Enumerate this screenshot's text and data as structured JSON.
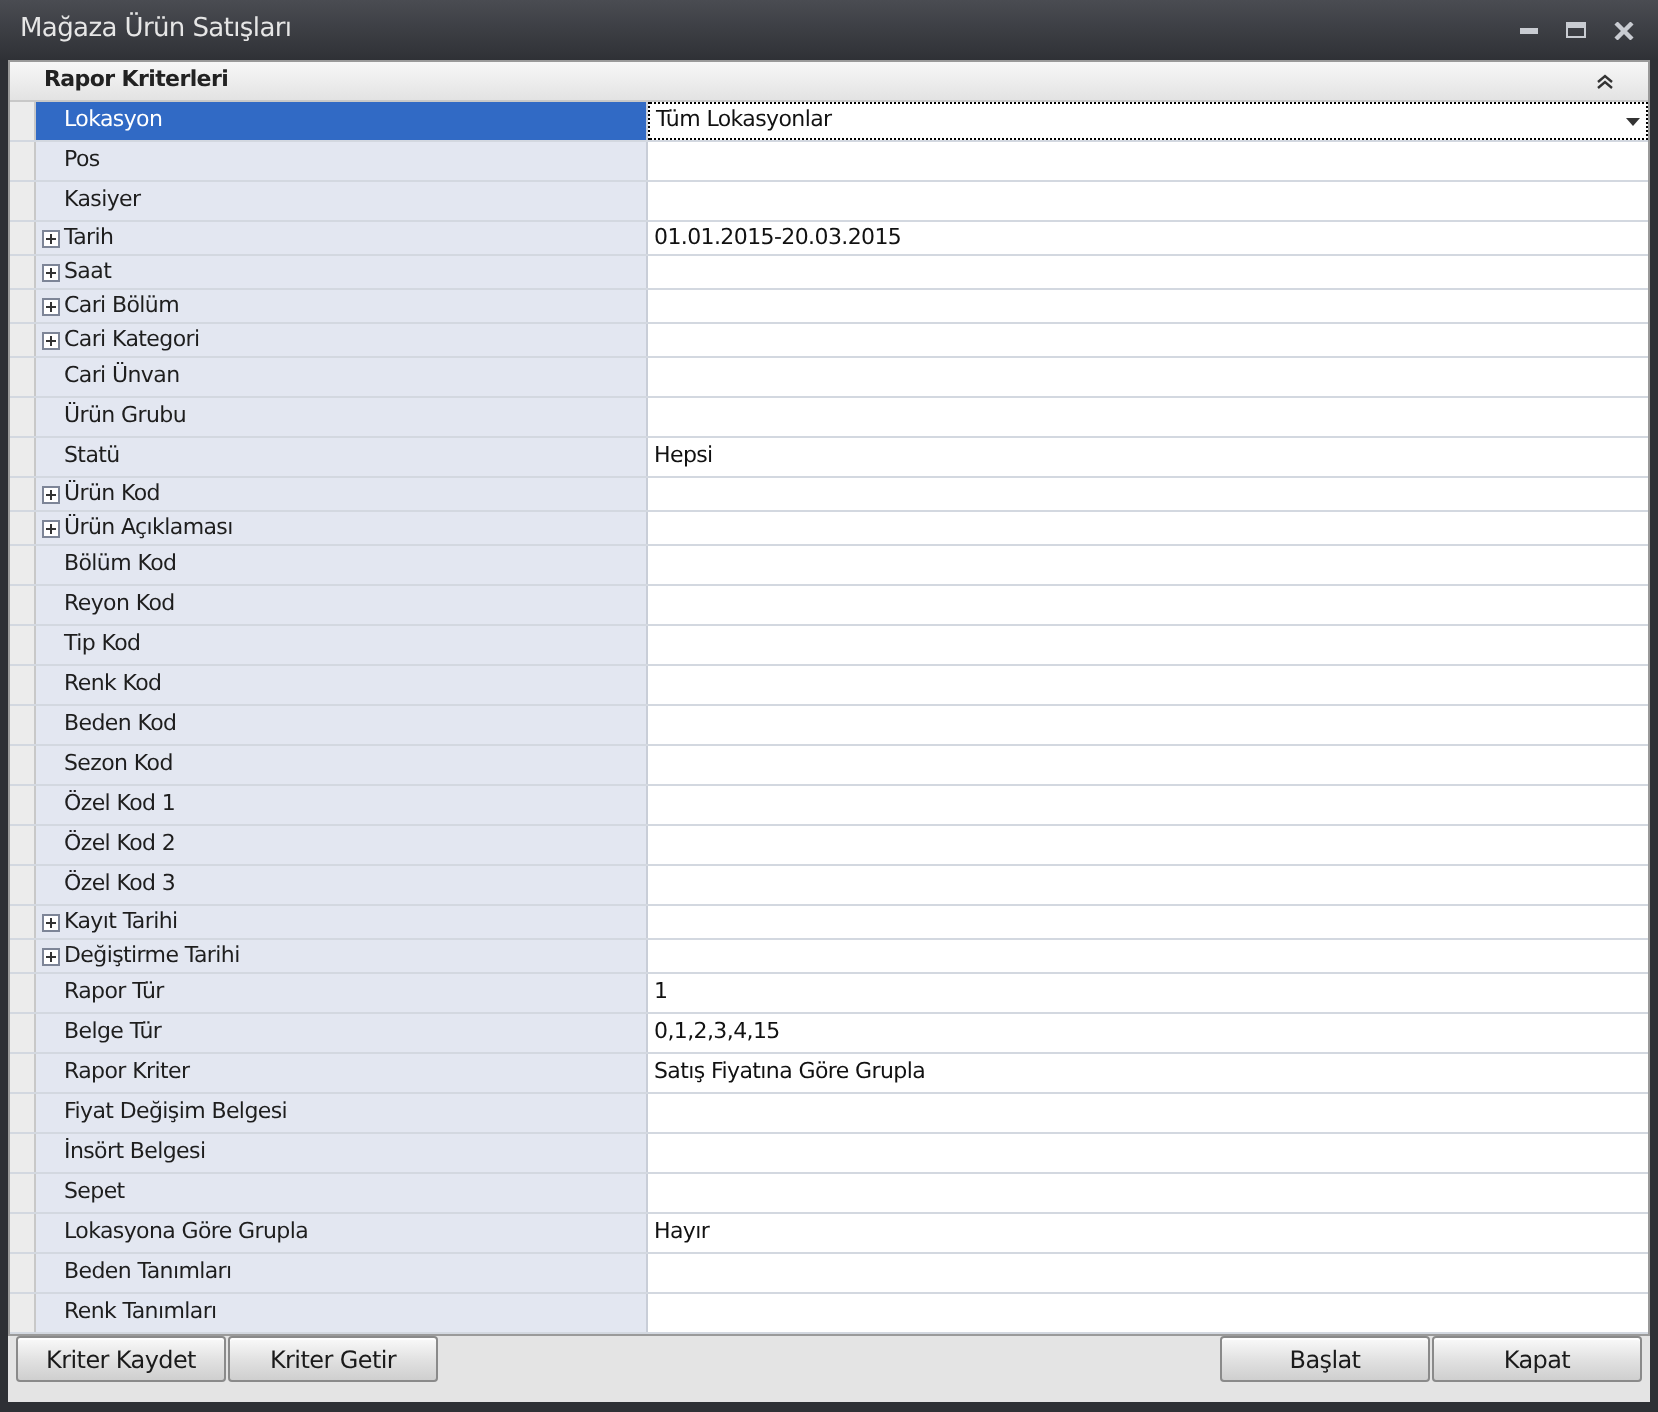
{
  "window": {
    "title": "Mağaza Ürün Satışları"
  },
  "panel": {
    "title": "Rapor Kriterleri",
    "expanded": true
  },
  "rows": [
    {
      "label": "Lokasyon",
      "value": "Tüm Lokasyonlar",
      "selected": true
    },
    {
      "label": "Pos",
      "selected": false
    },
    {
      "label": "Kasiyer",
      "selected": false
    },
    {
      "label": "Tarih",
      "value": "01.01.2015-20.03.2015",
      "selected": false,
      "expanded": false
    },
    {
      "label": "Saat",
      "selected": false,
      "expanded": false
    },
    {
      "label": "Cari Bölüm",
      "selected": false,
      "expanded": false
    },
    {
      "label": "Cari Kategori",
      "selected": false,
      "expanded": false
    },
    {
      "label": "Cari Ünvan",
      "selected": false
    },
    {
      "label": "Ürün Grubu",
      "selected": false
    },
    {
      "label": "Statü",
      "value": "Hepsi",
      "selected": false
    },
    {
      "label": "Ürün Kod",
      "selected": false,
      "expanded": false
    },
    {
      "label": "Ürün Açıklaması",
      "selected": false,
      "expanded": false
    },
    {
      "label": "Bölüm Kod",
      "selected": false
    },
    {
      "label": "Reyon Kod",
      "selected": false
    },
    {
      "label": "Tip Kod",
      "selected": false
    },
    {
      "label": "Renk Kod",
      "selected": false
    },
    {
      "label": "Beden Kod",
      "selected": false
    },
    {
      "label": "Sezon Kod",
      "selected": false
    },
    {
      "label": "Özel Kod 1",
      "selected": false
    },
    {
      "label": "Özel Kod 2",
      "selected": false
    },
    {
      "label": "Özel Kod 3",
      "selected": false
    },
    {
      "label": "Kayıt Tarihi",
      "selected": false,
      "expanded": false
    },
    {
      "label": "Değiştirme Tarihi",
      "selected": false,
      "expanded": false
    },
    {
      "label": "Rapor Tür",
      "value": "1",
      "selected": false
    },
    {
      "label": "Belge Tür",
      "value": "0,1,2,3,4,15",
      "selected": false
    },
    {
      "label": "Rapor Kriter",
      "value": "Satış Fiyatına Göre Grupla",
      "selected": false
    },
    {
      "label": "Fiyat Değişim Belgesi",
      "selected": false
    },
    {
      "label": "İnsört Belgesi",
      "selected": false
    },
    {
      "label": "Sepet",
      "selected": false
    },
    {
      "label": "Lokasyona Göre Grupla",
      "value": "Hayır",
      "selected": false
    },
    {
      "label": "Beden Tanımları",
      "selected": false
    },
    {
      "label": "Renk Tanımları",
      "selected": false
    }
  ],
  "buttons_left": [
    "Kriter Kaydet",
    "Kriter Getir"
  ],
  "buttons_right": [
    "Başlat",
    "Kapat"
  ]
}
